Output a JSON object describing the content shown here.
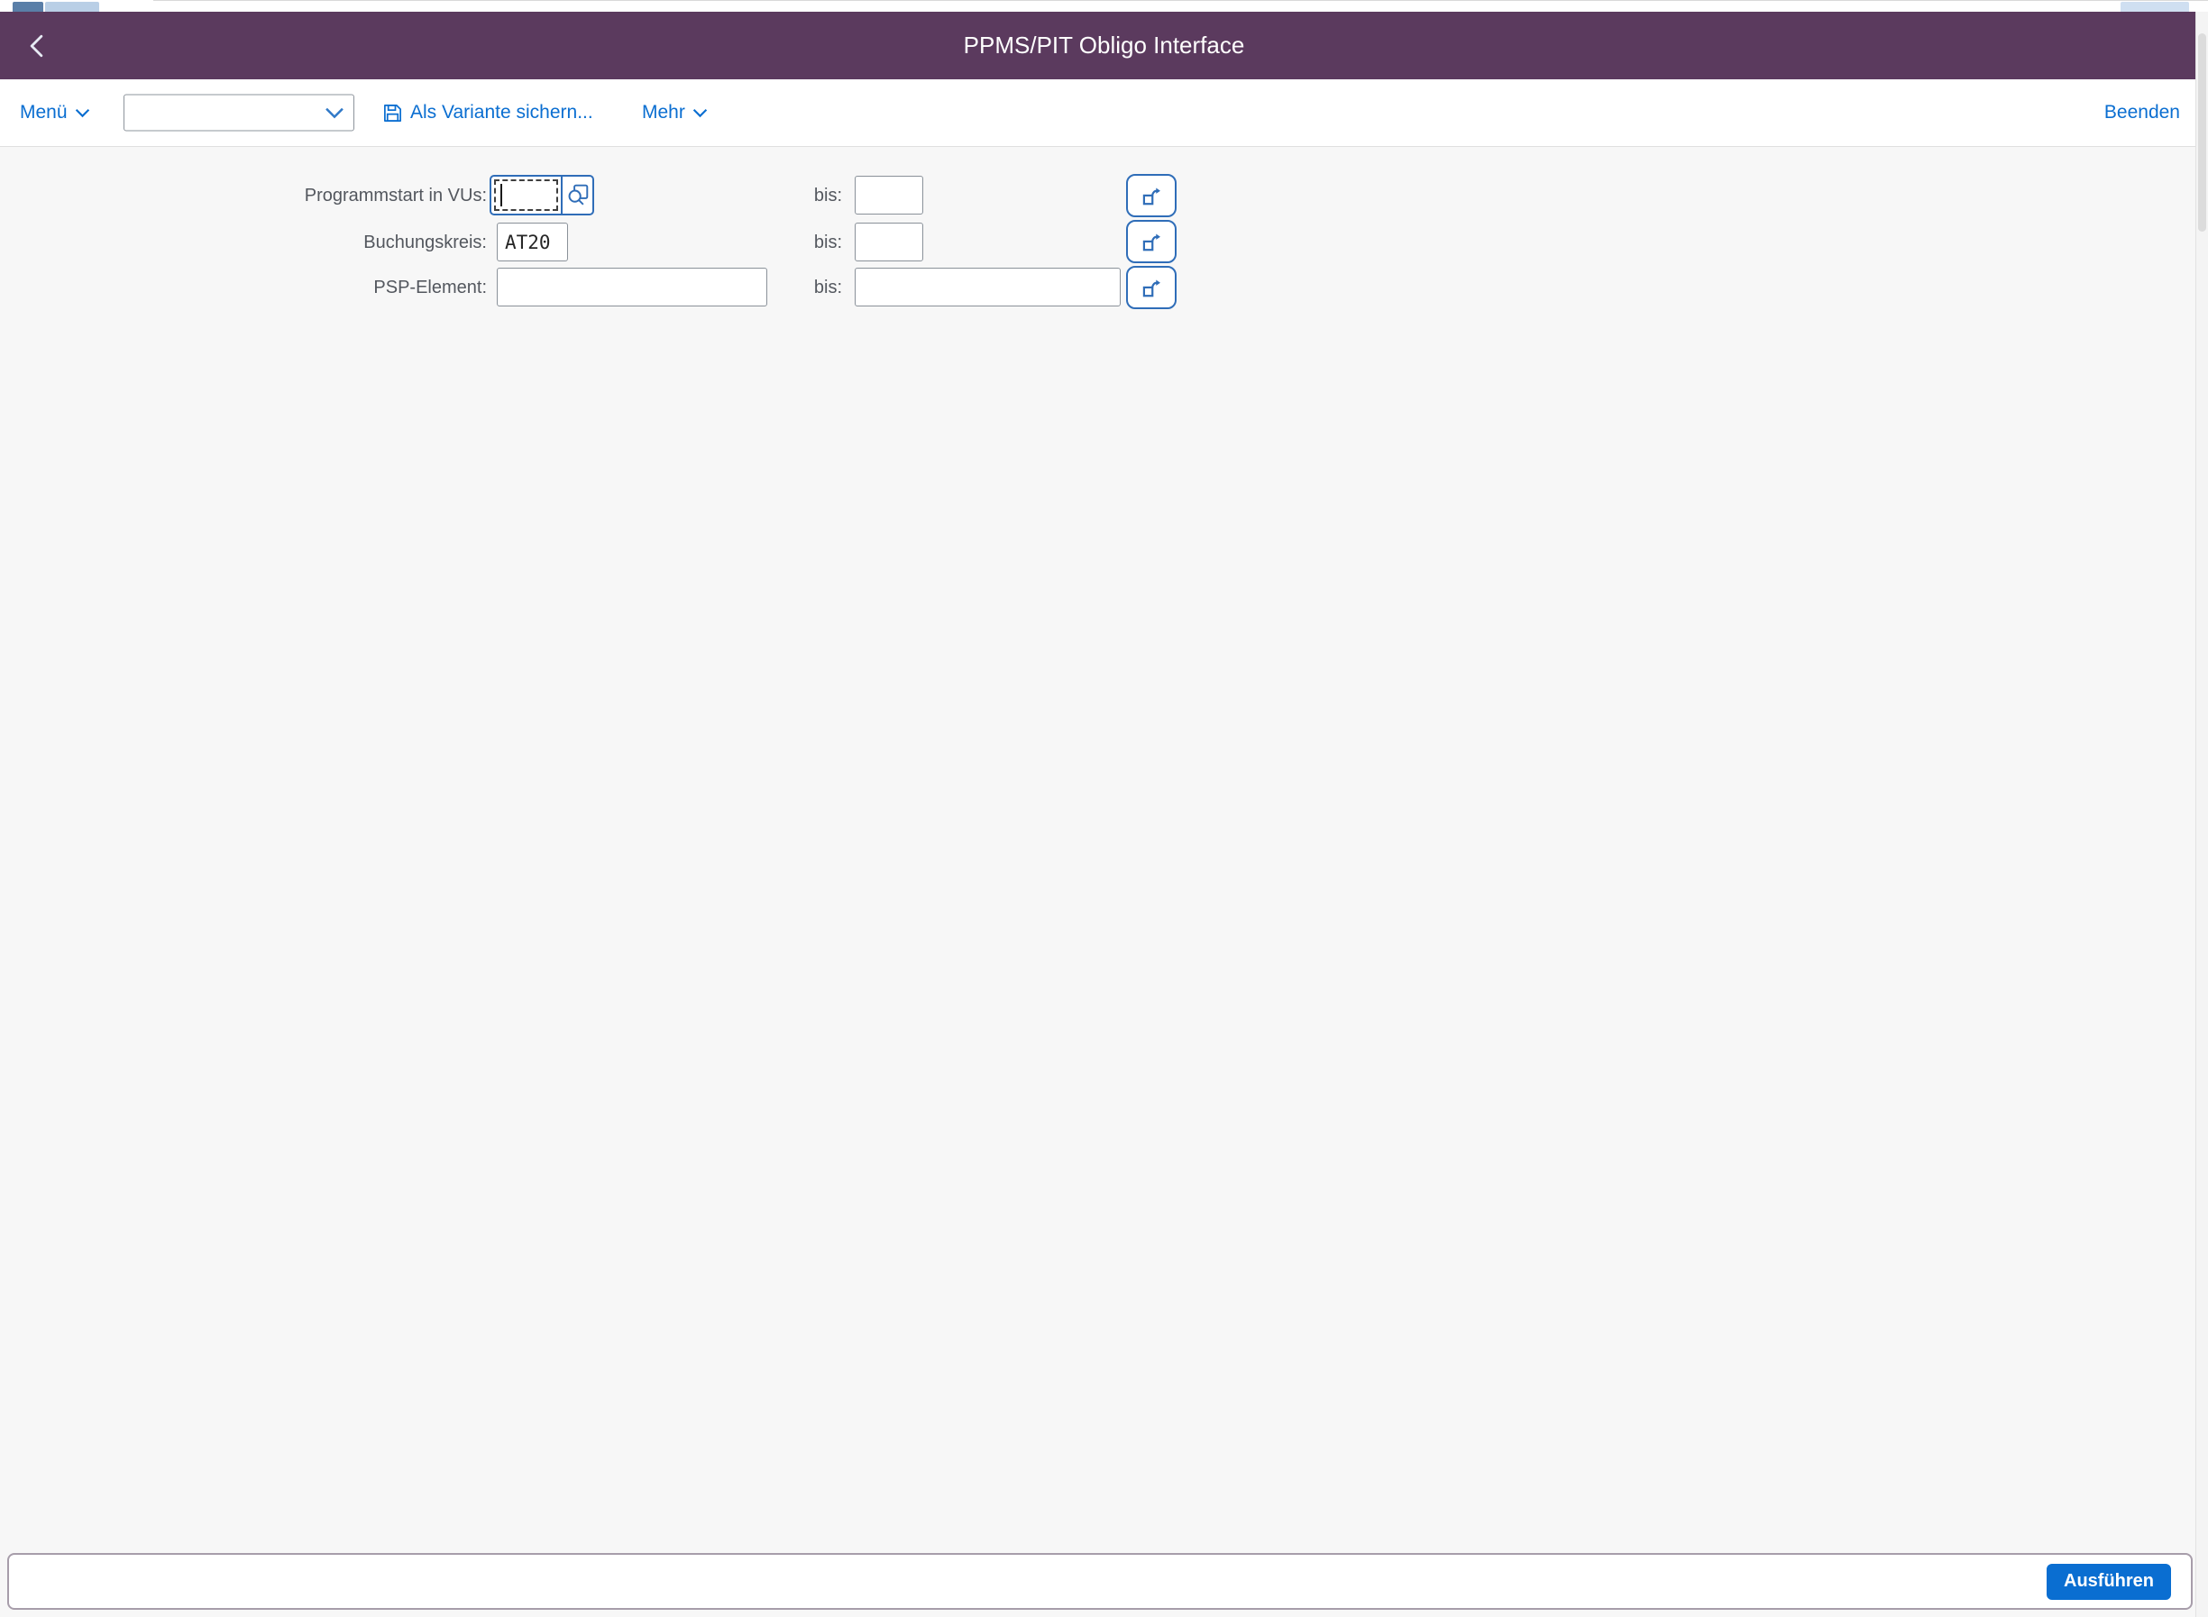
{
  "colors": {
    "shell_header_purple": "#5b3a5e",
    "accent_blue": "#0a6ed1",
    "field_focus_border_blue": "#2f6db8",
    "input_border_gray": "#8a9199",
    "content_background": "#f7f7f7",
    "footer_bar_border": "#a79daa"
  },
  "header": {
    "title": "PPMS/PIT Obligo Interface",
    "back_icon": "chevron-left"
  },
  "toolbar": {
    "menu": {
      "label": "Menü",
      "icon": "chevron-down"
    },
    "variant_select": {
      "value": "",
      "icon": "chevron-down"
    },
    "save_variant": {
      "label": "Als Variante sichern...",
      "icon": "floppy-disk"
    },
    "more": {
      "label": "Mehr",
      "icon": "chevron-down"
    },
    "exit": {
      "label": "Beenden"
    }
  },
  "form": {
    "rows": [
      {
        "label": "Programmstart in VUs:",
        "value": "",
        "value_help_icon": "value-help-magnifier",
        "bis_label": "bis:",
        "bis_value": "",
        "range_icon": "range-selection-arrow"
      },
      {
        "label": "Buchungskreis:",
        "value": "AT20",
        "bis_label": "bis:",
        "bis_value": "",
        "range_icon": "range-selection-arrow"
      },
      {
        "label": "PSP-Element:",
        "value": "",
        "bis_label": "bis:",
        "bis_value": "",
        "range_icon": "range-selection-arrow"
      }
    ]
  },
  "footer": {
    "message_value": "",
    "execute": {
      "label": "Ausführen"
    }
  }
}
